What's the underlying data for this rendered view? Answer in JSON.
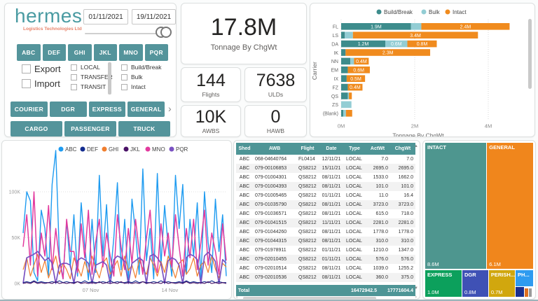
{
  "brand": {
    "name": "hermes",
    "tagline": "Logistics Technologies Ltd",
    "name_color": "#4A9BA2",
    "tagline_color": "#E8836A"
  },
  "colors": {
    "accent_teal": "#54949B",
    "table_header": "#4E9596",
    "build_break": "#3D8C8C",
    "bulk": "#93CDD4",
    "intact": "#F08B1E",
    "scrollbar": "#c9c9c9"
  },
  "filters": {
    "date_from": "01/11/2021",
    "date_to": "19/11/2021",
    "shed_buttons": [
      "ABC",
      "DEF",
      "GHI",
      "JKL",
      "MNO",
      "PQR"
    ],
    "direction_checkboxes": [
      "Export",
      "Import"
    ],
    "movement_checkboxes": [
      "LOCAL",
      "TRANSFER",
      "TRANSIT"
    ],
    "handling_checkboxes": [
      "Build/Break",
      "Bulk",
      "Intact"
    ],
    "product_buttons_row1": [
      "COURIER",
      "DGR",
      "EXPRESS",
      "GENERAL"
    ],
    "product_buttons_row2": [
      "CARGO",
      "PASSENGER",
      "TRUCK"
    ],
    "more_arrow": "›"
  },
  "kpis": [
    {
      "value": "17.8M",
      "label": "Tonnage By ChgWt"
    },
    {
      "value": "144",
      "label": "Flights"
    },
    {
      "value": "7638",
      "label": "ULDs"
    },
    {
      "value": "10K",
      "label": "AWBS"
    },
    {
      "value": "0",
      "label": "HAWB"
    }
  ],
  "chart_data": [
    {
      "type": "bar",
      "orientation": "horizontal",
      "xlabel": "Tonnage By ChgWt",
      "ylabel": "Carrier",
      "legend_position": "top",
      "grid": "vertical-dotted",
      "categories": [
        "FL",
        "LS",
        "DA",
        "IK",
        "NN",
        "EM",
        "IX",
        "FZ",
        "QS",
        "ZS",
        "(Blank)"
      ],
      "series": [
        {
          "name": "Build/Break",
          "color": "#3D8C8C",
          "values": [
            1.9,
            0.1,
            1.2,
            0.12,
            0.25,
            0.18,
            0.15,
            0.18,
            0.18,
            0,
            0.06
          ],
          "labels": [
            "1.9M",
            "",
            "1.2M",
            "",
            "",
            "",
            "",
            "",
            "",
            "",
            ""
          ]
        },
        {
          "name": "Bulk",
          "color": "#93CDD4",
          "values": [
            0.28,
            0.22,
            0.6,
            0,
            0.1,
            0,
            0,
            0,
            0.03,
            0.28,
            0.07
          ],
          "labels": [
            "",
            "",
            "0.6M",
            "",
            "",
            "",
            "",
            "",
            "",
            "",
            ""
          ]
        },
        {
          "name": "Intact",
          "color": "#F08B1E",
          "values": [
            2.4,
            3.4,
            0.8,
            2.3,
            0.4,
            0.6,
            0.5,
            0.4,
            0.08,
            0,
            0.17
          ],
          "labels": [
            "2.4M",
            "3.4M",
            "0.8M",
            "2.3M",
            "0.4M",
            "0.6M",
            "0.5M",
            "0.4M",
            "",
            "",
            ""
          ]
        }
      ],
      "xticks": [
        "0M",
        "2M",
        "4M"
      ],
      "xlim": [
        0,
        5.15
      ]
    },
    {
      "type": "line",
      "legend_position": "top",
      "grid": "horizontal-dotted",
      "yticks": [
        "0K",
        "50K",
        "100K"
      ],
      "ylim_k": [
        0,
        135
      ],
      "xticks": [
        {
          "label": "07 Nov",
          "frac": 0.333
        },
        {
          "label": "14 Nov",
          "frac": 0.722
        }
      ],
      "series": [
        {
          "name": "ABC",
          "color": "#1E9BF0",
          "values_k": [
            55,
            100,
            90,
            12,
            3,
            80,
            60,
            9,
            108,
            145,
            30,
            5,
            68,
            18,
            75,
            8,
            88,
            40,
            4,
            70,
            12,
            118,
            30,
            86,
            6,
            50,
            110,
            15,
            70,
            3,
            92,
            55,
            10,
            125,
            25,
            60,
            5,
            120,
            20,
            85,
            40,
            8,
            118,
            60,
            108,
            10,
            70,
            30,
            88,
            5,
            100,
            45,
            12,
            92,
            35,
            75,
            8
          ]
        },
        {
          "name": "DEF",
          "color": "#132C8F",
          "values_k": [
            1,
            2,
            1,
            3,
            1,
            2,
            1,
            1,
            2,
            1,
            3,
            1,
            2,
            1,
            1,
            2,
            1,
            3,
            1,
            2,
            1,
            1,
            2,
            1,
            3,
            1,
            2,
            1,
            1,
            2,
            1,
            3,
            1,
            2,
            1,
            1,
            2,
            1,
            3,
            1,
            2,
            1,
            1,
            2,
            1,
            3,
            1,
            2,
            1,
            1,
            2,
            1,
            3,
            1,
            2,
            1,
            1
          ]
        },
        {
          "name": "GHI",
          "color": "#F07E2E",
          "values_k": [
            15,
            28,
            8,
            20,
            32,
            12,
            25,
            6,
            18,
            30,
            10,
            22,
            15,
            5,
            28,
            18,
            8,
            24,
            12,
            30,
            16,
            6,
            22,
            28,
            10,
            18,
            25,
            8,
            30,
            14,
            20,
            6,
            26,
            16,
            10,
            28,
            20,
            8,
            24,
            12,
            30,
            18,
            6,
            22,
            26,
            10,
            16,
            28,
            8,
            20,
            24,
            12,
            30,
            16,
            6,
            22,
            18
          ]
        },
        {
          "name": "JKL",
          "color": "#4A1266",
          "values_k": [
            0,
            1,
            0,
            2,
            0,
            1,
            0,
            1,
            0,
            2,
            0,
            1,
            0,
            1,
            0,
            2,
            0,
            1,
            0,
            1,
            0,
            2,
            0,
            1,
            0,
            1,
            0,
            2,
            0,
            1,
            0,
            1,
            0,
            2,
            0,
            1,
            0,
            1,
            0,
            2,
            0,
            1,
            0,
            1,
            0,
            2,
            0,
            1,
            0,
            1,
            0,
            2,
            0,
            1,
            0,
            1,
            0
          ]
        },
        {
          "name": "MNO",
          "color": "#E23A9E",
          "values_k": [
            40,
            75,
            20,
            100,
            8,
            55,
            30,
            85,
            15,
            60,
            25,
            5,
            70,
            35,
            35,
            12,
            65,
            28,
            80,
            10,
            45,
            70,
            18,
            55,
            30,
            8,
            75,
            40,
            15,
            60,
            22,
            70,
            35,
            10,
            50,
            80,
            25,
            12,
            65,
            30,
            55,
            18,
            75,
            40,
            8,
            60,
            28,
            70,
            15,
            45,
            80,
            20,
            55,
            35,
            10,
            65,
            25
          ]
        },
        {
          "name": "PQR",
          "color": "#7A52C2",
          "values_k": [
            0,
            28,
            30,
            32,
            35,
            30,
            25,
            28,
            22,
            0,
            20,
            22,
            22,
            20,
            0,
            25,
            28,
            26,
            22,
            0,
            20,
            22,
            24,
            20,
            0,
            26,
            30,
            28,
            24,
            0,
            22,
            25,
            28,
            25,
            0,
            30,
            32,
            28,
            22,
            0,
            25,
            28,
            26,
            20,
            0,
            28,
            32,
            30,
            26,
            0,
            30,
            34,
            30,
            24,
            0,
            26,
            22
          ]
        }
      ]
    },
    {
      "type": "treemap",
      "items": [
        {
          "label": "INTACT",
          "value": "8.6M",
          "color": "#4E968F"
        },
        {
          "label": "GENERAL",
          "value": "6.1M",
          "color": "#F0861C"
        },
        {
          "label": "EXPRESS",
          "value": "1.0M",
          "color": "#0CA05C"
        },
        {
          "label": "DGR",
          "value": "0.8M",
          "color": "#3F51B5"
        },
        {
          "label": "PERISH...",
          "value": "0.7M",
          "color": "#D1A70E"
        },
        {
          "label": "PH...",
          "value": "",
          "color": "#2E9BF0"
        },
        {
          "label": "",
          "value": "",
          "color": "#1A2F8F"
        },
        {
          "label": "",
          "value": "",
          "color": "#E07020"
        },
        {
          "label": "",
          "value": "",
          "color": "#9A9A9A"
        }
      ]
    }
  ],
  "table": {
    "columns": [
      "Shed",
      "AWB",
      "Flight",
      "Date",
      "Type",
      "ActWt",
      "ChgWt"
    ],
    "rows": [
      [
        "ABC",
        "068-04640764",
        "FL0414",
        "12/11/21",
        "LOCAL",
        "7.0",
        "7.0"
      ],
      [
        "ABC",
        "079-00106853",
        "QS8212",
        "15/11/21",
        "LOCAL",
        "2695.0",
        "2695.0"
      ],
      [
        "ABC",
        "079-01004301",
        "QS8212",
        "08/11/21",
        "LOCAL",
        "1533.0",
        "1662.0"
      ],
      [
        "ABC",
        "079-01004393",
        "QS8212",
        "08/11/21",
        "LOCAL",
        "101.0",
        "101.0"
      ],
      [
        "ABC",
        "079-01005465",
        "QS8212",
        "01/11/21",
        "LOCAL",
        "11.0",
        "16.4"
      ],
      [
        "ABC",
        "079-01035790",
        "QS8212",
        "08/11/21",
        "LOCAL",
        "3723.0",
        "3723.0"
      ],
      [
        "ABC",
        "079-01036571",
        "QS8212",
        "08/11/21",
        "LOCAL",
        "615.0",
        "718.0"
      ],
      [
        "ABC",
        "079-01041515",
        "QS8212",
        "11/11/21",
        "LOCAL",
        "2281.0",
        "2281.0"
      ],
      [
        "ABC",
        "079-01044260",
        "QS8212",
        "08/11/21",
        "LOCAL",
        "1778.0",
        "1778.0"
      ],
      [
        "ABC",
        "079-01044315",
        "QS8212",
        "08/11/21",
        "LOCAL",
        "310.0",
        "310.0"
      ],
      [
        "ABC",
        "079-01978911",
        "QS8212",
        "01/11/21",
        "LOCAL",
        "1210.0",
        "1347.0"
      ],
      [
        "ABC",
        "079-02010455",
        "QS8212",
        "01/11/21",
        "LOCAL",
        "576.0",
        "576.0"
      ],
      [
        "ABC",
        "079-02010514",
        "QS8212",
        "08/11/21",
        "LOCAL",
        "1039.0",
        "1255.2"
      ],
      [
        "ABC",
        "079-02010536",
        "QS8212",
        "08/11/21",
        "LOCAL",
        "360.0",
        "375.0"
      ]
    ],
    "total_label": "Total",
    "total_actwt": "16472942.5",
    "total_chgwt": "17771604.4"
  }
}
